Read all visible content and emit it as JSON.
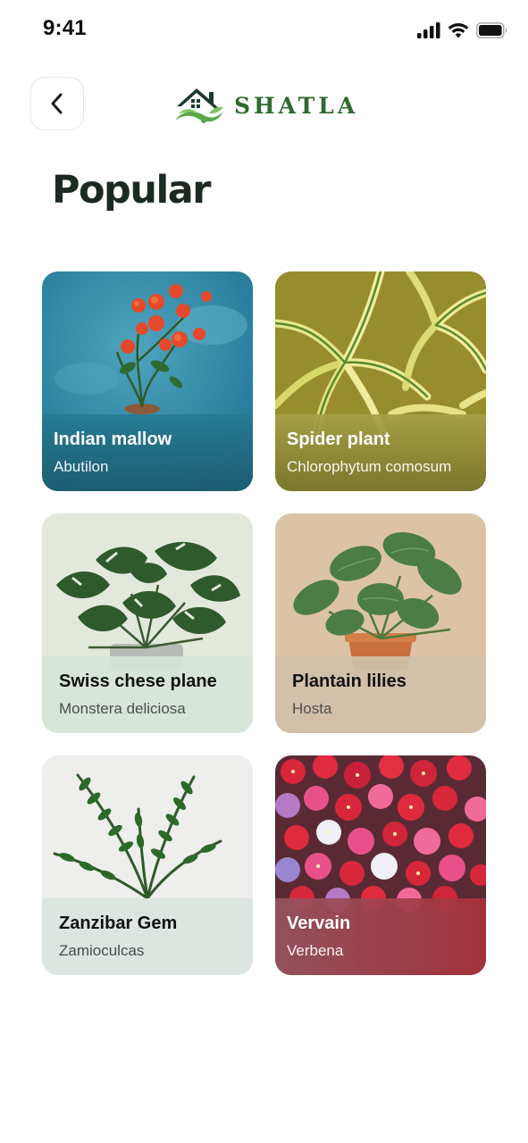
{
  "status_bar": {
    "time": "9:41",
    "icons": [
      "signal-icon",
      "wifi-icon",
      "battery-icon"
    ]
  },
  "header": {
    "back_icon": "chevron-left-icon",
    "logo_text": "SHATLA"
  },
  "page": {
    "title": "Popular"
  },
  "plants": [
    {
      "name": "Indian mallow",
      "scientific": "Abutilon",
      "theme": "dark",
      "accent": "#2a8aa8"
    },
    {
      "name": "Spider plant",
      "scientific": "Chlorophytum comosum",
      "theme": "dark",
      "accent": "#a8a046"
    },
    {
      "name": "Swiss chese plane",
      "scientific": "Monstera deliciosa",
      "theme": "light",
      "accent": "#e3eadc"
    },
    {
      "name": "Plantain lilies",
      "scientific": "Hosta",
      "theme": "light",
      "accent": "#d8c0a4"
    },
    {
      "name": "Zanzibar Gem",
      "scientific": "Zamioculcas",
      "theme": "light",
      "accent": "#ececea"
    },
    {
      "name": "Vervain",
      "scientific": "Verbena",
      "theme": "dark",
      "accent": "#c2283a"
    }
  ],
  "colors": {
    "title": "#1c2b22",
    "brand": "#2f6a2f"
  }
}
